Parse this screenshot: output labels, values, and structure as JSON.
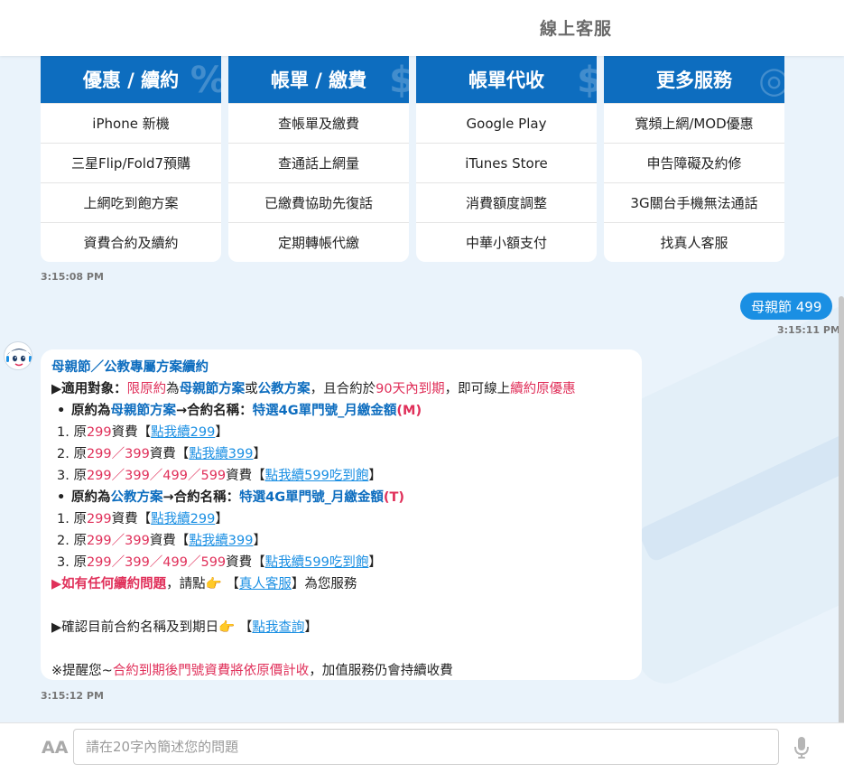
{
  "header": {
    "title": "線上客服"
  },
  "menu": [
    {
      "title": "優惠 / 續約",
      "deco": "%",
      "items": [
        "iPhone 新機",
        "三星Flip/Fold7預購",
        "上網吃到飽方案",
        "資費合約及續約"
      ]
    },
    {
      "title": "帳單 / 繳費",
      "deco": "$",
      "items": [
        "查帳單及繳費",
        "查通話上網量",
        "已繳費協助先復話",
        "定期轉帳代繳"
      ]
    },
    {
      "title": "帳單代收",
      "deco": "$",
      "items": [
        "Google Play",
        "iTunes Store",
        "消費額度調整",
        "中華小額支付"
      ]
    },
    {
      "title": "更多服務",
      "deco": "◎",
      "items": [
        "寬頻上網/MOD優惠",
        "申告障礙及約修",
        "3G關台手機無法通話",
        "找真人客服"
      ]
    }
  ],
  "timestamps": {
    "menu": "3:15:08 PM",
    "user": "3:15:11 PM",
    "bot": "3:15:12 PM"
  },
  "user_message": "母親節 499",
  "bot": {
    "title": "母親節／公教專屬方案續約",
    "l1": {
      "a": "▶適用對象：",
      "b": "限原約",
      "c": "為",
      "d": "母親節方案",
      "e": "或",
      "f": "公教方案",
      "g": "，且合約於",
      "h": "90天內到期",
      "i": "，即可線上",
      "j": "續約原優惠"
    },
    "sec1": {
      "a": "原約為",
      "b": "母親節方案",
      "c": "→合約名稱：",
      "d": "特選4G單門號_月繳金額",
      "e": "(M)"
    },
    "sec1_items": [
      {
        "n": "1. 原",
        "p": "299",
        "s": "資費【",
        "link": "點我續299",
        "e": "】"
      },
      {
        "n": "2. 原",
        "p": "299／399",
        "s": "資費【",
        "link": "點我續399",
        "e": "】"
      },
      {
        "n": "3. 原",
        "p": "299／399／499／599",
        "s": "資費【",
        "link": "點我續599吃到飽",
        "e": "】"
      }
    ],
    "sec2": {
      "a": "原約為",
      "b": "公教方案",
      "c": "→合約名稱：",
      "d": "特選4G單門號_月繳金額",
      "e": "(T)"
    },
    "sec2_items": [
      {
        "n": "1. 原",
        "p": "299",
        "s": "資費【",
        "link": "點我續299",
        "e": "】"
      },
      {
        "n": "2. 原",
        "p": "299／399",
        "s": "資費【",
        "link": "點我續399",
        "e": "】"
      },
      {
        "n": "3. 原",
        "p": "299／399／499／599",
        "s": "資費【",
        "link": "點我續599吃到飽",
        "e": "】"
      }
    ],
    "help": {
      "a": "▶如有任何續約問題",
      "b": "，請點",
      "hand": "👉",
      "c": " 【",
      "link": "真人客服",
      "d": "】為您服務"
    },
    "check": {
      "a": "▶確認目前合約名稱及到期日",
      "hand": "👉",
      "b": " 【",
      "link": "點我查詢",
      "c": "】"
    },
    "remind": {
      "a": "※提醒您~",
      "b": "合約到期後門號資費將依原價計收",
      "c": "，加值服務仍會持續收費"
    }
  },
  "input": {
    "font_toggle": "AA",
    "placeholder": "請在20字內簡述您的問題",
    "value": ""
  }
}
